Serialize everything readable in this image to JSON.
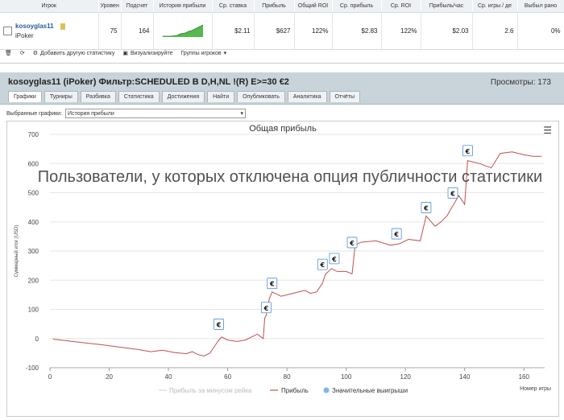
{
  "stats_table": {
    "headers": [
      "Игрок",
      "Уровен",
      "Подсчет",
      "История прибыли",
      "Ср. ставка",
      "Прибыль",
      "Общий ROI",
      "Ср. прибыль",
      "Ср. ROI",
      "Прибыль/час",
      "Ср. игры / де",
      "Выбыл рано"
    ],
    "row": {
      "player": "kosoyglas11",
      "room": "iPoker",
      "level": "75",
      "count": "164",
      "avg_stake": "$2.11",
      "profit": "$627",
      "total_roi": "122%",
      "avg_profit": "$2.83",
      "avg_roi": "122%",
      "profit_per_hour": "$2.03",
      "avg_games": "2.6",
      "early_out": "0%"
    },
    "toolbar": {
      "add_stats": "Добавить другую статистику",
      "visualize": "Визуализируйте",
      "groups": "Группы игроков"
    }
  },
  "panel": {
    "title": "kosoyglas11 (iPoker) Фильтр:SCHEDULED B D,H,NL !(R) E>=30 €2",
    "views_label": "Просмотры: 173",
    "tabs": [
      "Графики",
      "Турниры",
      "Разбивка",
      "Статистика",
      "Достижения",
      "Найти",
      "Опубликовать",
      "Аналитика",
      "Отчёты"
    ],
    "selected_label": "Выбранные графики:",
    "selected_value": "История прибыли",
    "watermark": "Пользователи, у которых отключена опция публичности статистики"
  },
  "chart_data": {
    "type": "line",
    "title": "Общая прибыль",
    "xlabel": "Номер игры",
    "ylabel": "Суммарный итог (USD)",
    "xlim": [
      0,
      167
    ],
    "ylim": [
      -100,
      700
    ],
    "x_ticks": [
      0,
      20,
      40,
      60,
      80,
      100,
      120,
      140,
      160
    ],
    "y_ticks": [
      -100,
      0,
      100,
      200,
      300,
      400,
      500,
      600,
      700
    ],
    "legend": [
      "Прибыль за минусом рейка",
      "Прибыль",
      "Значительные выигрыши"
    ],
    "marker_label": "€",
    "series": [
      {
        "name": "Прибыль",
        "color": "#c0504d",
        "points": [
          [
            1,
            -2
          ],
          [
            6,
            -8
          ],
          [
            12,
            -15
          ],
          [
            18,
            -22
          ],
          [
            24,
            -30
          ],
          [
            30,
            -38
          ],
          [
            34,
            -45
          ],
          [
            38,
            -40
          ],
          [
            42,
            -48
          ],
          [
            46,
            -52
          ],
          [
            48,
            -45
          ],
          [
            50,
            -55
          ],
          [
            52,
            -60
          ],
          [
            54,
            -50
          ],
          [
            56,
            -20
          ],
          [
            57,
            -5
          ],
          [
            58,
            5
          ],
          [
            60,
            -5
          ],
          [
            63,
            -10
          ],
          [
            66,
            -5
          ],
          [
            68,
            5
          ],
          [
            70,
            15
          ],
          [
            72,
            0
          ],
          [
            72.5,
            70
          ],
          [
            73,
            80
          ],
          [
            74,
            135
          ],
          [
            75,
            160
          ],
          [
            78,
            145
          ],
          [
            82,
            155
          ],
          [
            86,
            165
          ],
          [
            88,
            155
          ],
          [
            90,
            160
          ],
          [
            92,
            190
          ],
          [
            93,
            220
          ],
          [
            95,
            240
          ],
          [
            97,
            230
          ],
          [
            100,
            230
          ],
          [
            102,
            222
          ],
          [
            103,
            320
          ],
          [
            105,
            330
          ],
          [
            110,
            335
          ],
          [
            115,
            320
          ],
          [
            118,
            325
          ],
          [
            121,
            340
          ],
          [
            125,
            335
          ],
          [
            127,
            420
          ],
          [
            130,
            385
          ],
          [
            132,
            400
          ],
          [
            134,
            420
          ],
          [
            136,
            455
          ],
          [
            138,
            490
          ],
          [
            140,
            460
          ],
          [
            141,
            610
          ],
          [
            145,
            600
          ],
          [
            149,
            585
          ],
          [
            152,
            635
          ],
          [
            156,
            640
          ],
          [
            160,
            630
          ],
          [
            163,
            625
          ],
          [
            166,
            625
          ]
        ]
      }
    ],
    "big_wins": [
      [
        57,
        45
      ],
      [
        73,
        102
      ],
      [
        75,
        185
      ],
      [
        92,
        250
      ],
      [
        96,
        270
      ],
      [
        102,
        325
      ],
      [
        117,
        355
      ],
      [
        127,
        445
      ],
      [
        136,
        495
      ],
      [
        141,
        640
      ]
    ]
  }
}
